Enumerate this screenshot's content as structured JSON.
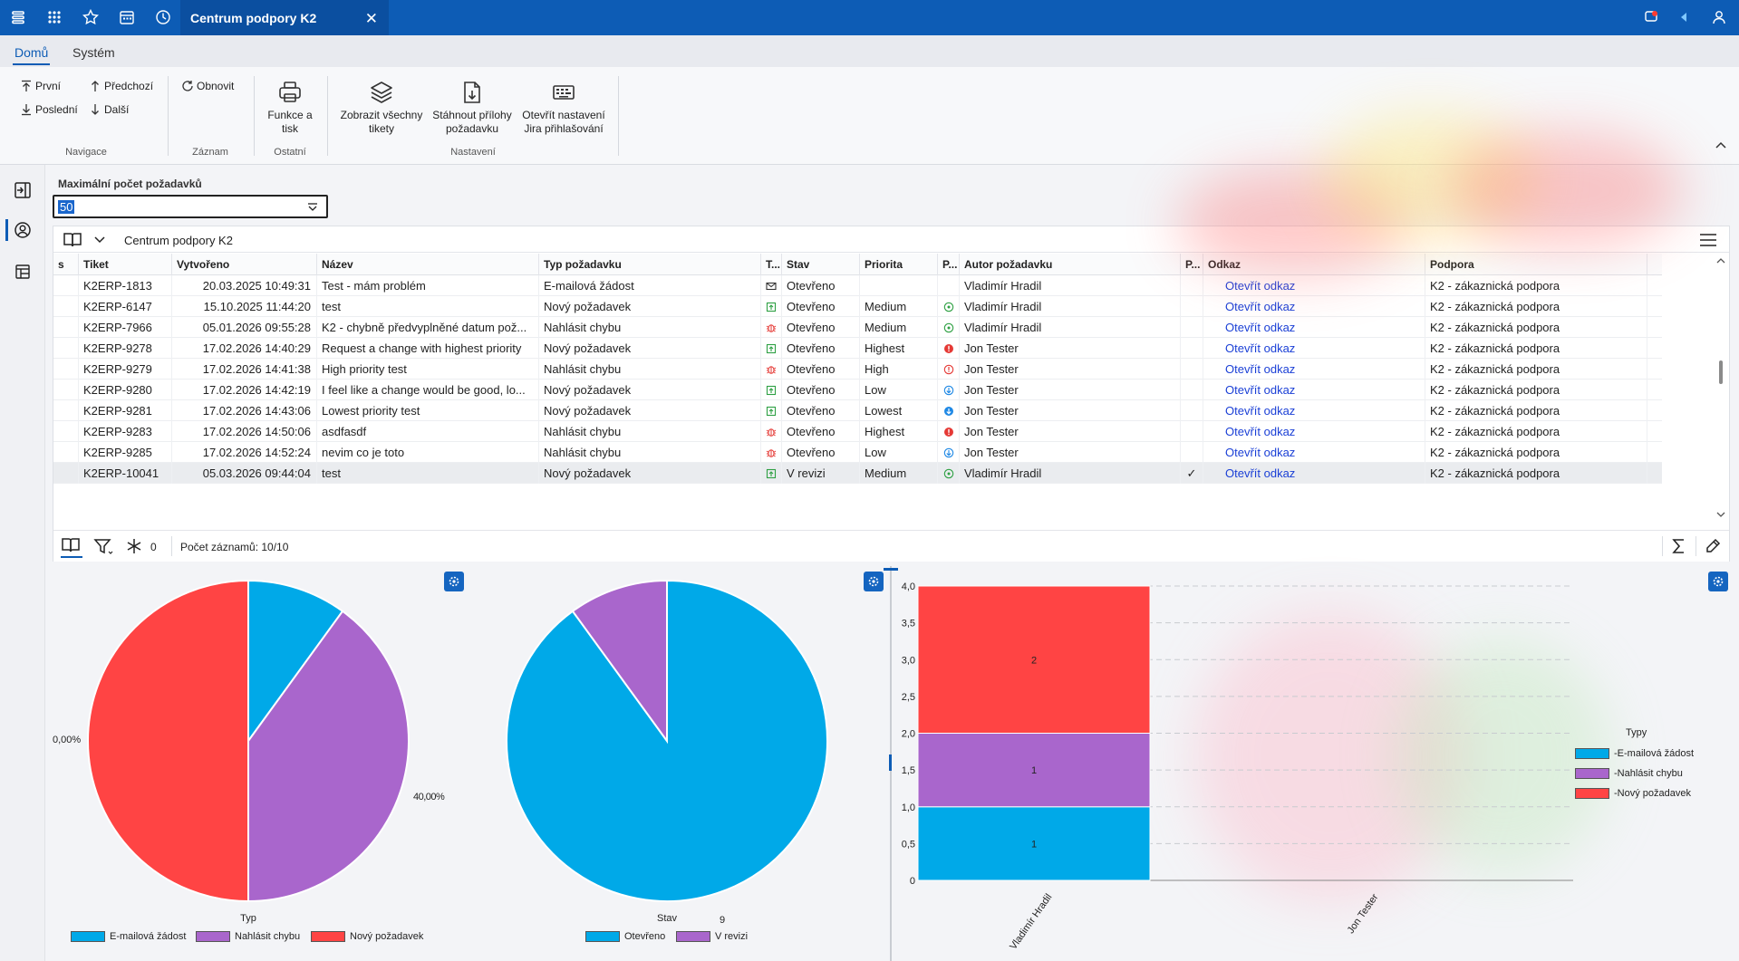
{
  "titlebar": {
    "tab_title": "Centrum podpory K2",
    "bg_color": "#0d5cb5"
  },
  "menu": {
    "items": [
      "Domů",
      "Systém"
    ]
  },
  "ribbon": {
    "nav": {
      "first": "První",
      "previous": "Předchozí",
      "last": "Poslední",
      "next": "Další",
      "group_label": "Navigace"
    },
    "record": {
      "refresh": "Obnovit",
      "group_label": "Záznam"
    },
    "other": {
      "print_line1": "Funkce a",
      "print_line2": "tisk",
      "group_label": "Ostatní"
    },
    "settings": {
      "show_all_line1": "Zobrazit všechny",
      "show_all_line2": "tikety",
      "download_line1": "Stáhnout přílohy",
      "download_line2": "požadavku",
      "jira_line1": "Otevřít nastavení",
      "jira_line2": "Jira přihlašování",
      "group_label": "Nastavení"
    }
  },
  "filter": {
    "label": "Maximální počet požadavků",
    "value": "50"
  },
  "grid": {
    "title": "Centrum podpory K2",
    "columns": [
      "s",
      "Tiket",
      "Vytvořeno",
      "Název",
      "Typ požadavku",
      "T...",
      "Stav",
      "Priorita",
      "P...",
      "Autor požadavku",
      "P...",
      "Odkaz",
      "Podpora"
    ],
    "rows": [
      {
        "tiket": "K2ERP-1813",
        "created": "20.03.2025 10:49:31",
        "name": "Test - mám problém",
        "type": "E-mailová žádost",
        "type_icon": "mail",
        "stav": "Otevřeno",
        "priorita": "",
        "prio_icon": "",
        "author": "Vladimír Hradil",
        "check": "",
        "link": "Otevřít odkaz",
        "podpora": "K2 - zákaznická podpora"
      },
      {
        "tiket": "K2ERP-6147",
        "created": "15.10.2025 11:44:20",
        "name": "test",
        "type": "Nový požadavek",
        "type_icon": "new",
        "stav": "Otevřeno",
        "priorita": "Medium",
        "prio_icon": "medium",
        "author": "Vladimír Hradil",
        "check": "",
        "link": "Otevřít odkaz",
        "podpora": "K2 - zákaznická podpora"
      },
      {
        "tiket": "K2ERP-7966",
        "created": "05.01.2026 09:55:28",
        "name": "K2 - chybně předvyplněné datum pož...",
        "type": "Nahlásit chybu",
        "type_icon": "bug",
        "stav": "Otevřeno",
        "priorita": "Medium",
        "prio_icon": "medium",
        "author": "Vladimír Hradil",
        "check": "",
        "link": "Otevřít odkaz",
        "podpora": "K2 - zákaznická podpora"
      },
      {
        "tiket": "K2ERP-9278",
        "created": "17.02.2026 14:40:29",
        "name": "Request a change with highest priority",
        "type": "Nový požadavek",
        "type_icon": "new",
        "stav": "Otevřeno",
        "priorita": "Highest",
        "prio_icon": "highest",
        "author": "Jon Tester",
        "check": "",
        "link": "Otevřít odkaz",
        "podpora": "K2 - zákaznická podpora"
      },
      {
        "tiket": "K2ERP-9279",
        "created": "17.02.2026 14:41:38",
        "name": "High priority test",
        "type": "Nahlásit chybu",
        "type_icon": "bug",
        "stav": "Otevřeno",
        "priorita": "High",
        "prio_icon": "high",
        "author": "Jon Tester",
        "check": "",
        "link": "Otevřít odkaz",
        "podpora": "K2 - zákaznická podpora"
      },
      {
        "tiket": "K2ERP-9280",
        "created": "17.02.2026 14:42:19",
        "name": "I feel like a change would be good, lo...",
        "type": "Nový požadavek",
        "type_icon": "new",
        "stav": "Otevřeno",
        "priorita": "Low",
        "prio_icon": "low",
        "author": "Jon Tester",
        "check": "",
        "link": "Otevřít odkaz",
        "podpora": "K2 - zákaznická podpora"
      },
      {
        "tiket": "K2ERP-9281",
        "created": "17.02.2026 14:43:06",
        "name": "Lowest priority test",
        "type": "Nový požadavek",
        "type_icon": "new",
        "stav": "Otevřeno",
        "priorita": "Lowest",
        "prio_icon": "lowest",
        "author": "Jon Tester",
        "check": "",
        "link": "Otevřít odkaz",
        "podpora": "K2 - zákaznická podpora"
      },
      {
        "tiket": "K2ERP-9283",
        "created": "17.02.2026 14:50:06",
        "name": "asdfasdf",
        "type": "Nahlásit chybu",
        "type_icon": "bug",
        "stav": "Otevřeno",
        "priorita": "Highest",
        "prio_icon": "highest",
        "author": "Jon Tester",
        "check": "",
        "link": "Otevřít odkaz",
        "podpora": "K2 - zákaznická podpora"
      },
      {
        "tiket": "K2ERP-9285",
        "created": "17.02.2026 14:52:24",
        "name": "nevim co je toto",
        "type": "Nahlásit chybu",
        "type_icon": "bug",
        "stav": "Otevřeno",
        "priorita": "Low",
        "prio_icon": "low",
        "author": "Jon Tester",
        "check": "",
        "link": "Otevřít odkaz",
        "podpora": "K2 - zákaznická podpora"
      },
      {
        "tiket": "K2ERP-10041",
        "created": "05.03.2026 09:44:04",
        "name": "test",
        "type": "Nový požadavek",
        "type_icon": "new",
        "stav": "V revizi",
        "priorita": "Medium",
        "prio_icon": "medium",
        "author": "Vladimír Hradil",
        "check": "✓",
        "link": "Otevřít odkaz",
        "podpora": "K2 - zákaznická podpora"
      }
    ],
    "footer": {
      "filter_count": "0",
      "records_text": "Počet záznamů: 10/10"
    }
  },
  "colors": {
    "email": "#00a9e8",
    "bug": "#a966cc",
    "new": "#ff4444",
    "open": "#00a9e8",
    "review": "#a966cc"
  },
  "chart_data": [
    {
      "type": "pie",
      "title": "",
      "xlabel": "Typ",
      "categories": [
        "E-mailová žádost",
        "Nahlásit chybu",
        "Nový požadavek"
      ],
      "values": [
        10,
        40,
        50
      ],
      "slice_labels": [
        "40,00%",
        "0,00%"
      ]
    },
    {
      "type": "pie",
      "title": "",
      "xlabel": "Stav",
      "extra_label": "9",
      "categories": [
        "Otevřeno",
        "V revizi"
      ],
      "values": [
        9,
        1
      ]
    },
    {
      "type": "bar",
      "stacked": true,
      "categories": [
        "Vladimír Hradil",
        "Jon Tester"
      ],
      "legend_title": "Typy",
      "series": [
        {
          "name": "-E-mailová žádost",
          "values": [
            1,
            0
          ]
        },
        {
          "name": "-Nahlásit chybu",
          "values": [
            1,
            0
          ]
        },
        {
          "name": "-Nový požadavek",
          "values": [
            2,
            0
          ]
        }
      ],
      "ylim": [
        0,
        4
      ],
      "yticks": [
        "0",
        "0,5",
        "1,0",
        "1,5",
        "2,0",
        "2,5",
        "3,0",
        "3,5",
        "4,0"
      ],
      "grid": true,
      "legend_position": "right"
    }
  ]
}
